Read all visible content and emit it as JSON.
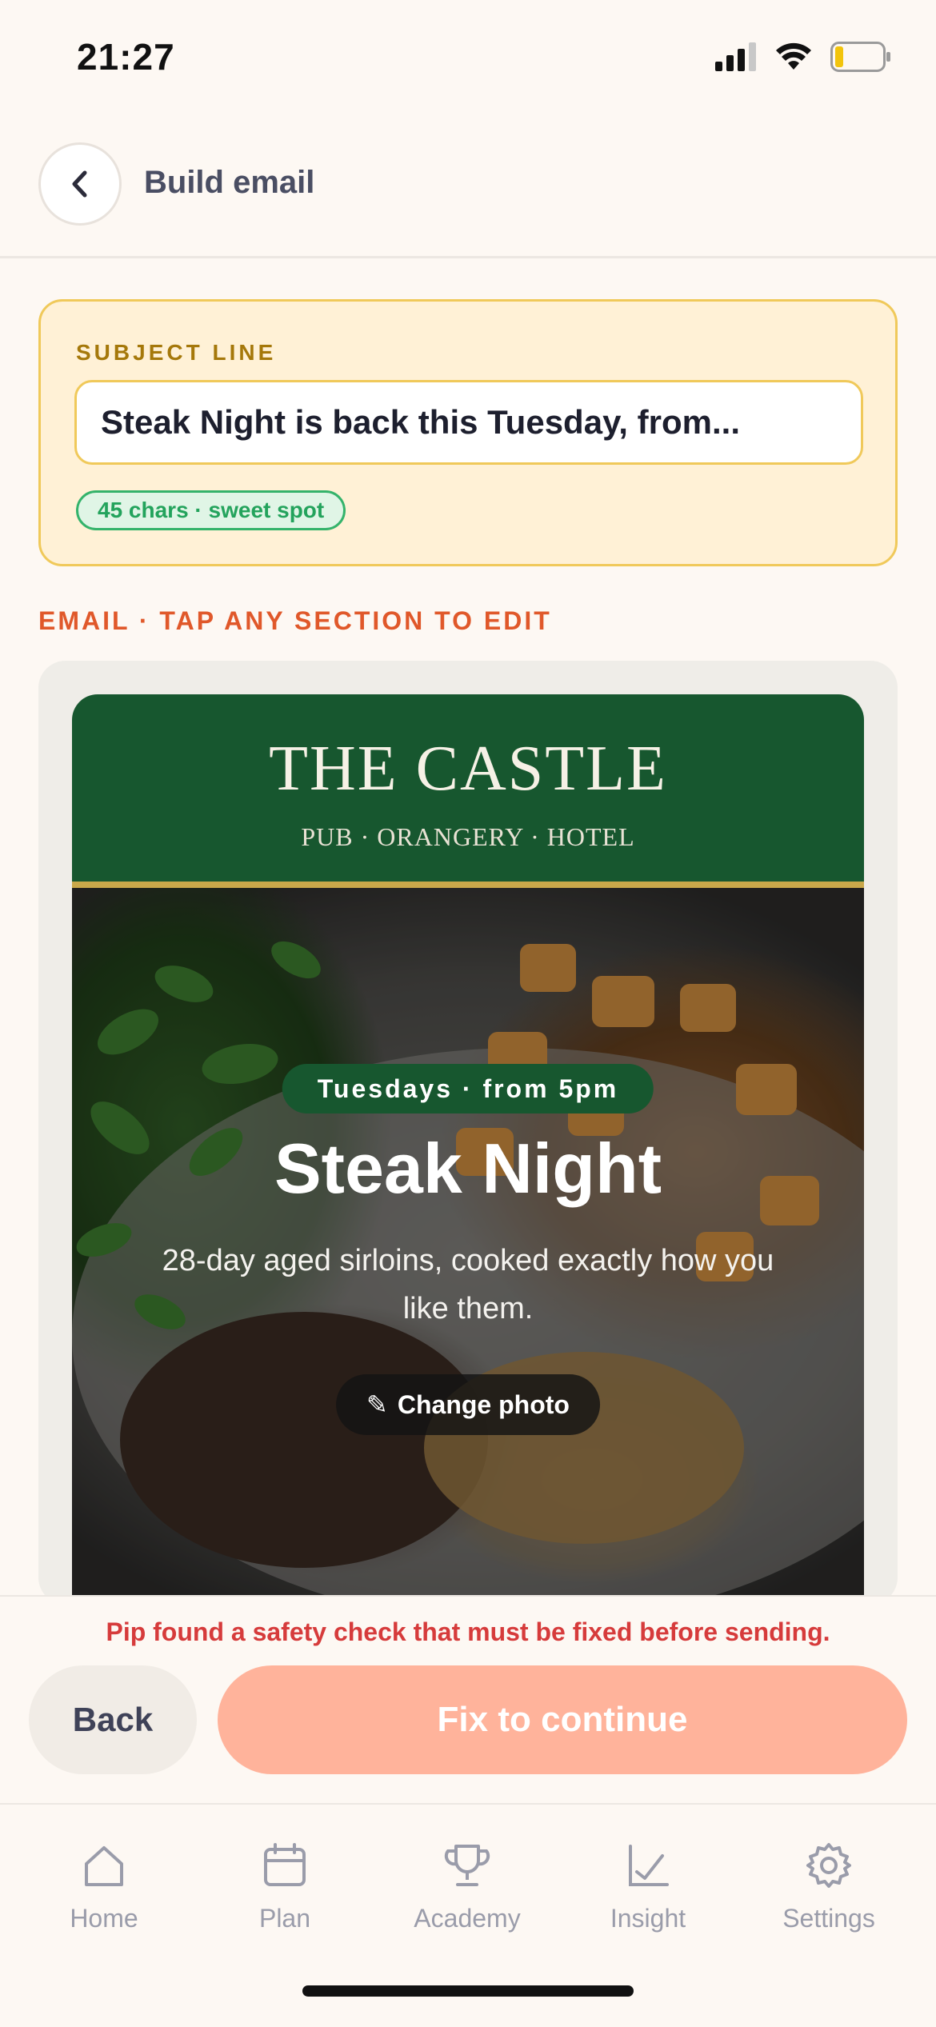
{
  "status_bar": {
    "time": "21:27"
  },
  "header": {
    "title": "Build email"
  },
  "subject": {
    "label": "SUBJECT LINE",
    "value": "Steak Night is back this Tuesday, from...",
    "chars_badge": "45 chars · sweet spot"
  },
  "email_section_label": "EMAIL · TAP ANY SECTION TO EDIT",
  "email": {
    "brand_name": "THE CASTLE",
    "brand_tagline": "PUB · ORANGERY · HOTEL",
    "badge": "Tuesdays · from 5pm",
    "title": "Steak Night",
    "subtitle": "28-day aged sirloins, cooked exactly how you like them.",
    "change_photo": "Change photo",
    "change_photo_icon": "✎"
  },
  "footer": {
    "safety_message": "Pip found a safety check that must be fixed before sending.",
    "back_label": "Back",
    "continue_label": "Fix to continue"
  },
  "tabs": [
    {
      "label": "Home",
      "icon": "home-icon"
    },
    {
      "label": "Plan",
      "icon": "calendar-icon"
    },
    {
      "label": "Academy",
      "icon": "trophy-icon"
    },
    {
      "label": "Insight",
      "icon": "chart-icon"
    },
    {
      "label": "Settings",
      "icon": "gear-icon"
    }
  ],
  "colors": {
    "accent": "#e0582a",
    "brand_green": "#17572f",
    "subject_bg": "#fff1d6",
    "danger": "#d63b3b",
    "cta_disabled": "#ffb39b"
  }
}
